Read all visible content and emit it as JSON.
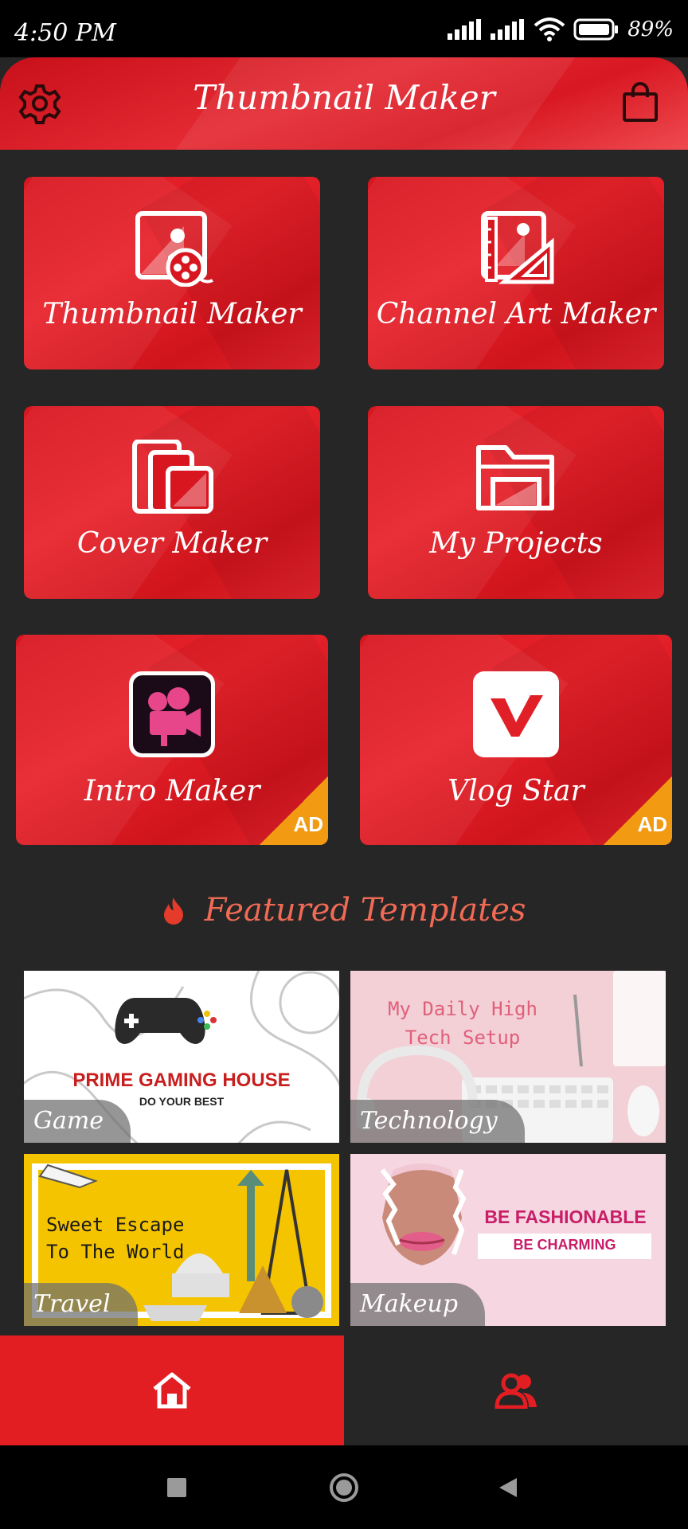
{
  "status_bar": {
    "time": "4:50 PM",
    "battery": "89%"
  },
  "header": {
    "title": "Thumbnail Maker",
    "settings_icon": "gear-icon",
    "store_icon": "shopping-bag-icon"
  },
  "tools": [
    {
      "label": "Thumbnail Maker",
      "icon": "image-film-icon"
    },
    {
      "label": "Channel Art Maker",
      "icon": "image-ruler-icon"
    },
    {
      "label": "Cover Maker",
      "icon": "layered-images-icon"
    },
    {
      "label": "My Projects",
      "icon": "folder-icon"
    },
    {
      "label": "Intro Maker",
      "icon": "intro-maker-app-icon",
      "badge": "AD"
    },
    {
      "label": "Vlog Star",
      "icon": "vlog-star-app-icon",
      "badge": "AD"
    }
  ],
  "featured": {
    "title": "Featured Templates",
    "icon": "fire-icon"
  },
  "templates": [
    {
      "label": "Game",
      "headline": "PRIME GAMING HOUSE",
      "subline": "DO YOUR BEST"
    },
    {
      "label": "Technology",
      "headline": "My Daily High Tech Setup"
    },
    {
      "label": "Travel",
      "headline": "Sweet Escape To The World"
    },
    {
      "label": "Makeup",
      "headline": "BE FASHIONABLE",
      "subline": "BE CHARMING"
    }
  ],
  "bottom_nav": {
    "home_icon": "home-icon",
    "profile_icon": "users-icon"
  },
  "colors": {
    "accent": "#e21e22",
    "background": "#262626",
    "featured_title": "#f06a55",
    "ad_badge": "#f29a12"
  }
}
